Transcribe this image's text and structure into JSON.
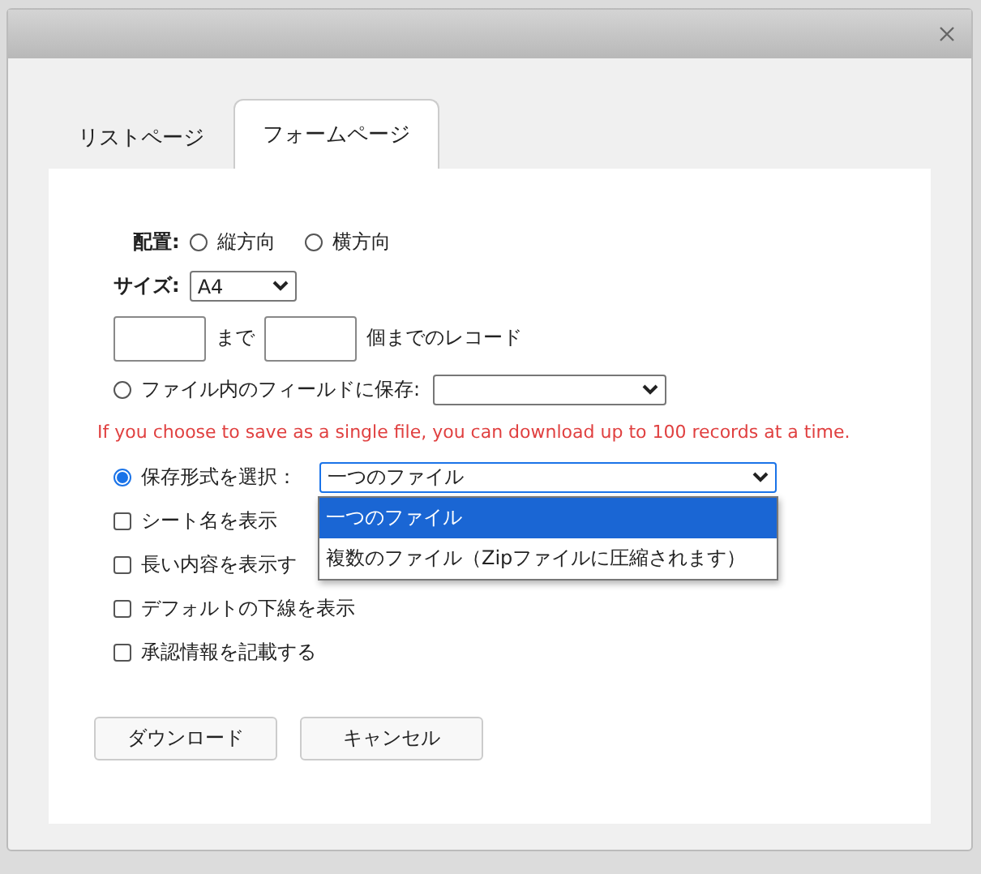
{
  "tabs": [
    {
      "label": "リストページ",
      "selected": false
    },
    {
      "label": "フォームページ",
      "selected": true
    }
  ],
  "orientation": {
    "label": "配置:",
    "options": [
      {
        "label": "縦方向",
        "selected": false
      },
      {
        "label": "横方向",
        "selected": false
      }
    ]
  },
  "size": {
    "label": "サイズ:",
    "value": "A4"
  },
  "range": {
    "between": "まで",
    "suffix": "個までのレコード"
  },
  "save_modes": [
    {
      "kind": "field",
      "label": "ファイル内のフィールドに保存:",
      "selected": false
    },
    {
      "kind": "format",
      "label": "保存形式を選択：",
      "selected": true,
      "value": "一つのファイル",
      "expanded": true,
      "options": [
        {
          "label": "一つのファイル",
          "selected": true
        },
        {
          "label": "複数のファイル（Zipファイルに圧縮されます）",
          "selected": false
        }
      ]
    }
  ],
  "warning": "If you choose to save as a single file, you can download up to 100 records at a time.",
  "checkboxes": [
    {
      "label": "シート名を表示",
      "checked": false
    },
    {
      "label": "長い内容を表示す",
      "checked": false
    },
    {
      "label": "デフォルトの下線を表示",
      "checked": false
    },
    {
      "label": "承認情報を記載する",
      "checked": false
    }
  ],
  "buttons": [
    "ダウンロード",
    "キャンセル"
  ]
}
